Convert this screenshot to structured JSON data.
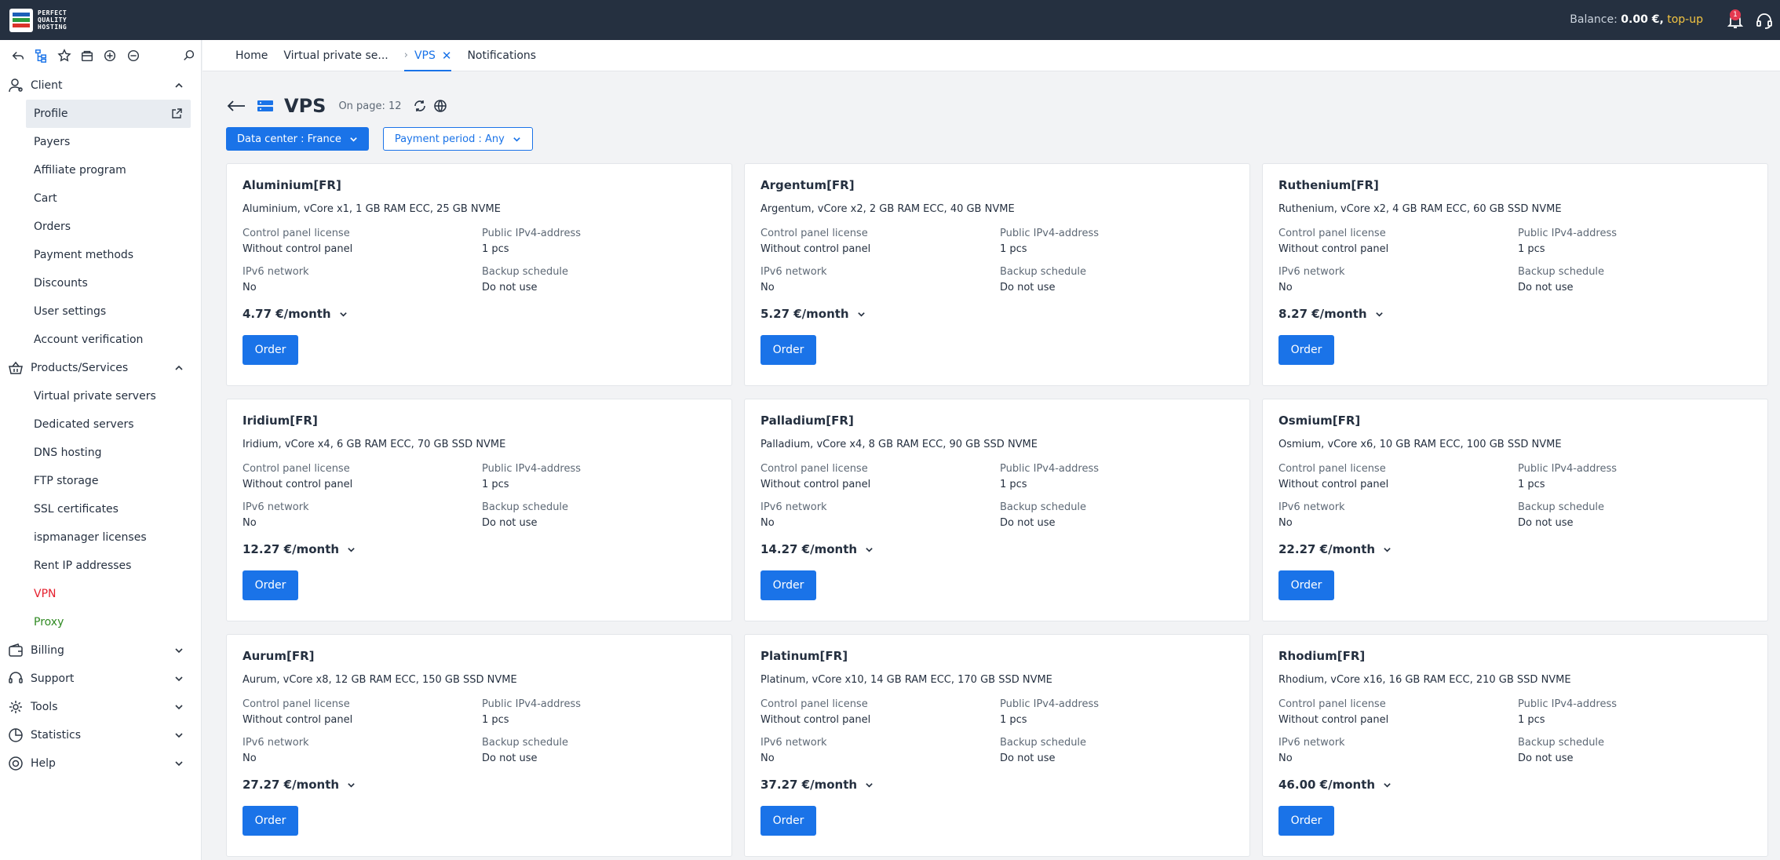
{
  "header": {
    "logo_lines": [
      "PERFECT",
      "QUALITY",
      "HOSTING"
    ],
    "balance_label": "Balance:",
    "balance_value": "0.00 €,",
    "topup_label": "top-up",
    "notifications_count": "1"
  },
  "tabs": [
    {
      "label": "Home"
    },
    {
      "label": "Virtual private se..."
    },
    {
      "label": "VPS"
    },
    {
      "label": "Notifications"
    }
  ],
  "sidebar": {
    "client_label": "Client",
    "client_items": [
      "Profile",
      "Payers",
      "Affiliate program",
      "Cart",
      "Orders",
      "Payment methods",
      "Discounts",
      "User settings",
      "Account verification"
    ],
    "products_label": "Products/Services",
    "products_items": [
      "Virtual private servers",
      "Dedicated servers",
      "DNS hosting",
      "FTP storage",
      "SSL certificates",
      "ispmanager licenses",
      "Rent IP addresses",
      "VPN",
      "Proxy"
    ],
    "groups": [
      "Billing",
      "Support",
      "Tools",
      "Statistics",
      "Help"
    ]
  },
  "page": {
    "title": "VPS",
    "on_page": "On page: 12",
    "filter_datacenter": "Data center : France",
    "filter_period": "Payment period : Any"
  },
  "labels": {
    "control_panel": "Control panel license",
    "ipv4": "Public IPv4-address",
    "ipv6": "IPv6 network",
    "backup": "Backup schedule",
    "order": "Order"
  },
  "cards": [
    {
      "name": "Aluminium[FR]",
      "desc": "Aluminium, vCore x1, 1 GB RAM ECC, 25 GB NVME",
      "control_panel": "Without control panel",
      "ipv4": "1 pcs",
      "ipv6": "No",
      "backup": "Do not use",
      "price": "4.77 €/month"
    },
    {
      "name": "Argentum[FR]",
      "desc": "Argentum, vCore x2, 2 GB RAM ECC, 40 GB NVME",
      "control_panel": "Without control panel",
      "ipv4": "1 pcs",
      "ipv6": "No",
      "backup": "Do not use",
      "price": "5.27 €/month"
    },
    {
      "name": "Ruthenium[FR]",
      "desc": "Ruthenium, vCore x2, 4 GB RAM ECC, 60 GB SSD NVME",
      "control_panel": "Without control panel",
      "ipv4": "1 pcs",
      "ipv6": "No",
      "backup": "Do not use",
      "price": "8.27 €/month"
    },
    {
      "name": "Iridium[FR]",
      "desc": "Iridium, vCore x4, 6 GB RAM ECC, 70 GB SSD NVME",
      "control_panel": "Without control panel",
      "ipv4": "1 pcs",
      "ipv6": "No",
      "backup": "Do not use",
      "price": "12.27 €/month"
    },
    {
      "name": "Palladium[FR]",
      "desc": "Palladium, vCore x4, 8 GB RAM ECC, 90 GB SSD NVME",
      "control_panel": "Without control panel",
      "ipv4": "1 pcs",
      "ipv6": "No",
      "backup": "Do not use",
      "price": "14.27 €/month"
    },
    {
      "name": "Osmium[FR]",
      "desc": "Osmium, vCore x6, 10 GB RAM ECC, 100 GB SSD NVME",
      "control_panel": "Without control panel",
      "ipv4": "1 pcs",
      "ipv6": "No",
      "backup": "Do not use",
      "price": "22.27 €/month"
    },
    {
      "name": "Aurum[FR]",
      "desc": "Aurum, vCore x8, 12 GB RAM ECC, 150 GB SSD NVME",
      "control_panel": "Without control panel",
      "ipv4": "1 pcs",
      "ipv6": "No",
      "backup": "Do not use",
      "price": "27.27 €/month"
    },
    {
      "name": "Platinum[FR]",
      "desc": "Platinum, vCore x10, 14 GB RAM ECC, 170 GB SSD NVME",
      "control_panel": "Without control panel",
      "ipv4": "1 pcs",
      "ipv6": "No",
      "backup": "Do not use",
      "price": "37.27 €/month"
    },
    {
      "name": "Rhodium[FR]",
      "desc": "Rhodium, vCore x16, 16 GB RAM ECC, 210 GB SSD NVME",
      "control_panel": "Without control panel",
      "ipv4": "1 pcs",
      "ipv6": "No",
      "backup": "Do not use",
      "price": "46.00 €/month"
    }
  ],
  "colors": {
    "topbar": "#253040",
    "accent": "#1a73e8",
    "vpn": "#e5202e",
    "proxy": "#2f8a22"
  }
}
